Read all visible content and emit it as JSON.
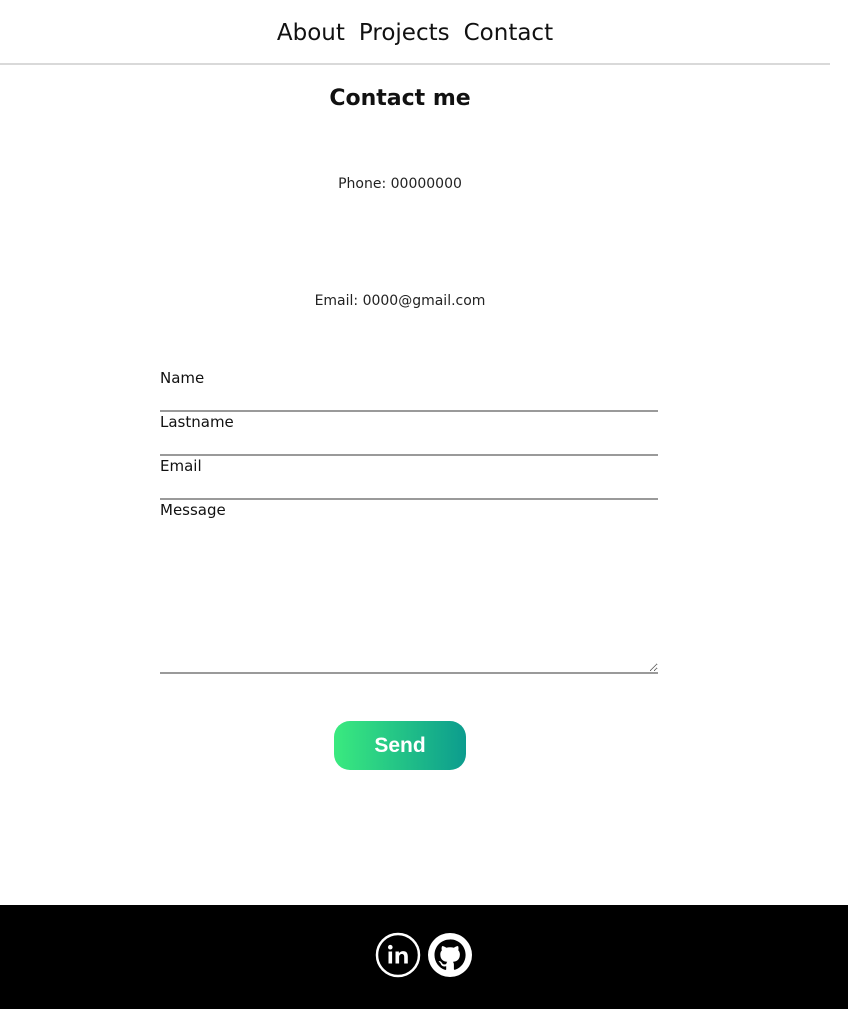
{
  "nav": {
    "items": [
      {
        "label": "About"
      },
      {
        "label": "Projects"
      },
      {
        "label": "Contact"
      }
    ]
  },
  "contact": {
    "title": "Contact me",
    "phone": "Phone: 00000000",
    "email": "Email: 0000@gmail.com"
  },
  "form": {
    "name_label": "Name",
    "name_value": "",
    "lastname_label": "Lastname",
    "lastname_value": "",
    "email_label": "Email",
    "email_value": "",
    "message_label": "Message",
    "message_value": "",
    "send_label": "Send"
  },
  "footer": {
    "icons": [
      "linkedin-icon",
      "github-icon"
    ]
  },
  "colors": {
    "button_gradient_start": "#3aea7f",
    "button_gradient_end": "#0c9c8e",
    "footer_background": "#000000"
  }
}
